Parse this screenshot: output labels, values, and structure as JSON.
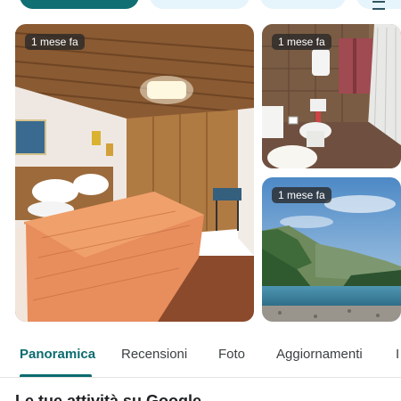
{
  "photos": {
    "main": {
      "time_label": "1 mese fa"
    },
    "bathroom": {
      "time_label": "1 mese fa"
    },
    "lake": {
      "time_label": "1 mese fa"
    }
  },
  "tabs": [
    {
      "label": "Panoramica",
      "active": true
    },
    {
      "label": "Recensioni",
      "active": false
    },
    {
      "label": "Foto",
      "active": false
    },
    {
      "label": "Aggiornamenti",
      "active": false
    },
    {
      "label": "I",
      "active": false
    }
  ],
  "section": {
    "title": "Le tue attività su Google"
  },
  "colors": {
    "accent": "#0b6b6f",
    "chip_primary": "#0f6f73",
    "chip_light": "#e6f4fb"
  }
}
